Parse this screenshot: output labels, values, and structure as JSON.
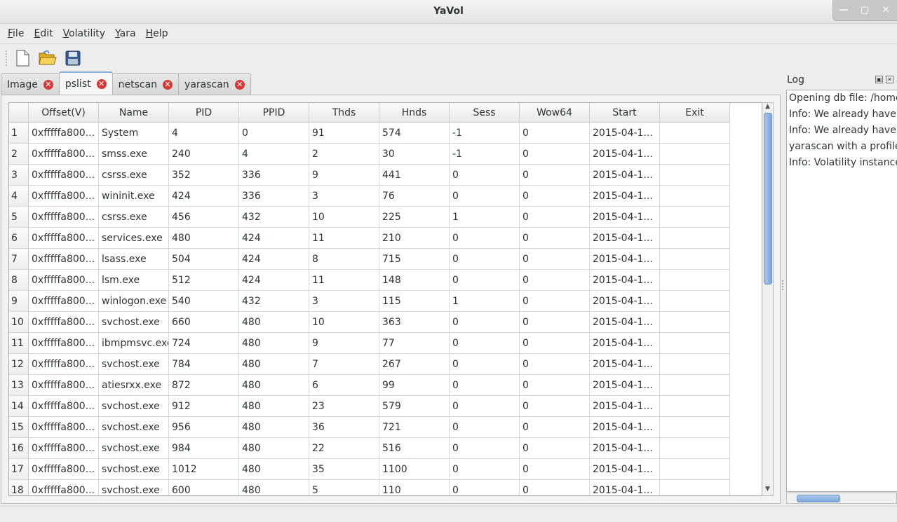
{
  "window": {
    "title": "YaVol"
  },
  "menu": [
    {
      "label": "File"
    },
    {
      "label": "Edit"
    },
    {
      "label": "Volatility"
    },
    {
      "label": "Yara"
    },
    {
      "label": "Help"
    }
  ],
  "tabs": [
    {
      "label": "Image"
    },
    {
      "label": "pslist"
    },
    {
      "label": "netscan"
    },
    {
      "label": "yarascan"
    }
  ],
  "table": {
    "columns": [
      "Offset(V)",
      "Name",
      "PID",
      "PPID",
      "Thds",
      "Hnds",
      "Sess",
      "Wow64",
      "Start",
      "Exit"
    ],
    "rows": [
      [
        "1",
        "0xfffffa800...",
        "System",
        "4",
        "0",
        "91",
        "574",
        "-1",
        "0",
        "2015-04-1...",
        ""
      ],
      [
        "2",
        "0xfffffa800...",
        "smss.exe",
        "240",
        "4",
        "2",
        "30",
        "-1",
        "0",
        "2015-04-1...",
        ""
      ],
      [
        "3",
        "0xfffffa800...",
        "csrss.exe",
        "352",
        "336",
        "9",
        "441",
        "0",
        "0",
        "2015-04-1...",
        ""
      ],
      [
        "4",
        "0xfffffa800...",
        "wininit.exe",
        "424",
        "336",
        "3",
        "76",
        "0",
        "0",
        "2015-04-1...",
        ""
      ],
      [
        "5",
        "0xfffffa800...",
        "csrss.exe",
        "456",
        "432",
        "10",
        "225",
        "1",
        "0",
        "2015-04-1...",
        ""
      ],
      [
        "6",
        "0xfffffa800...",
        "services.exe",
        "480",
        "424",
        "11",
        "210",
        "0",
        "0",
        "2015-04-1...",
        ""
      ],
      [
        "7",
        "0xfffffa800...",
        "lsass.exe",
        "504",
        "424",
        "8",
        "715",
        "0",
        "0",
        "2015-04-1...",
        ""
      ],
      [
        "8",
        "0xfffffa800...",
        "lsm.exe",
        "512",
        "424",
        "11",
        "148",
        "0",
        "0",
        "2015-04-1...",
        ""
      ],
      [
        "9",
        "0xfffffa800...",
        "winlogon.exe",
        "540",
        "432",
        "3",
        "115",
        "1",
        "0",
        "2015-04-1...",
        ""
      ],
      [
        "10",
        "0xfffffa800...",
        "svchost.exe",
        "660",
        "480",
        "10",
        "363",
        "0",
        "0",
        "2015-04-1...",
        ""
      ],
      [
        "11",
        "0xfffffa800...",
        "ibmpmsvc.exe",
        "724",
        "480",
        "9",
        "77",
        "0",
        "0",
        "2015-04-1...",
        ""
      ],
      [
        "12",
        "0xfffffa800...",
        "svchost.exe",
        "784",
        "480",
        "7",
        "267",
        "0",
        "0",
        "2015-04-1...",
        ""
      ],
      [
        "13",
        "0xfffffa800...",
        "atiesrxx.exe",
        "872",
        "480",
        "6",
        "99",
        "0",
        "0",
        "2015-04-1...",
        ""
      ],
      [
        "14",
        "0xfffffa800...",
        "svchost.exe",
        "912",
        "480",
        "23",
        "579",
        "0",
        "0",
        "2015-04-1...",
        ""
      ],
      [
        "15",
        "0xfffffa800...",
        "svchost.exe",
        "956",
        "480",
        "36",
        "721",
        "0",
        "0",
        "2015-04-1...",
        ""
      ],
      [
        "16",
        "0xfffffa800...",
        "svchost.exe",
        "984",
        "480",
        "22",
        "516",
        "0",
        "0",
        "2015-04-1...",
        ""
      ],
      [
        "17",
        "0xfffffa800...",
        "svchost.exe",
        "1012",
        "480",
        "35",
        "1100",
        "0",
        "0",
        "2015-04-1...",
        ""
      ],
      [
        "18",
        "0xfffffa800...",
        "svchost.exe",
        "600",
        "480",
        "5",
        "110",
        "0",
        "0",
        "2015-04-1...",
        ""
      ]
    ]
  },
  "log": {
    "title": "Log",
    "lines": [
      "Opening db file: /home/v",
      "Info: We already have th",
      "Info: We already have th",
      "yarascan with a profile o",
      "Info: Volatility instance"
    ]
  },
  "colors": {
    "accent": "#7ea7d8",
    "tab_close": "#d43a3a"
  }
}
